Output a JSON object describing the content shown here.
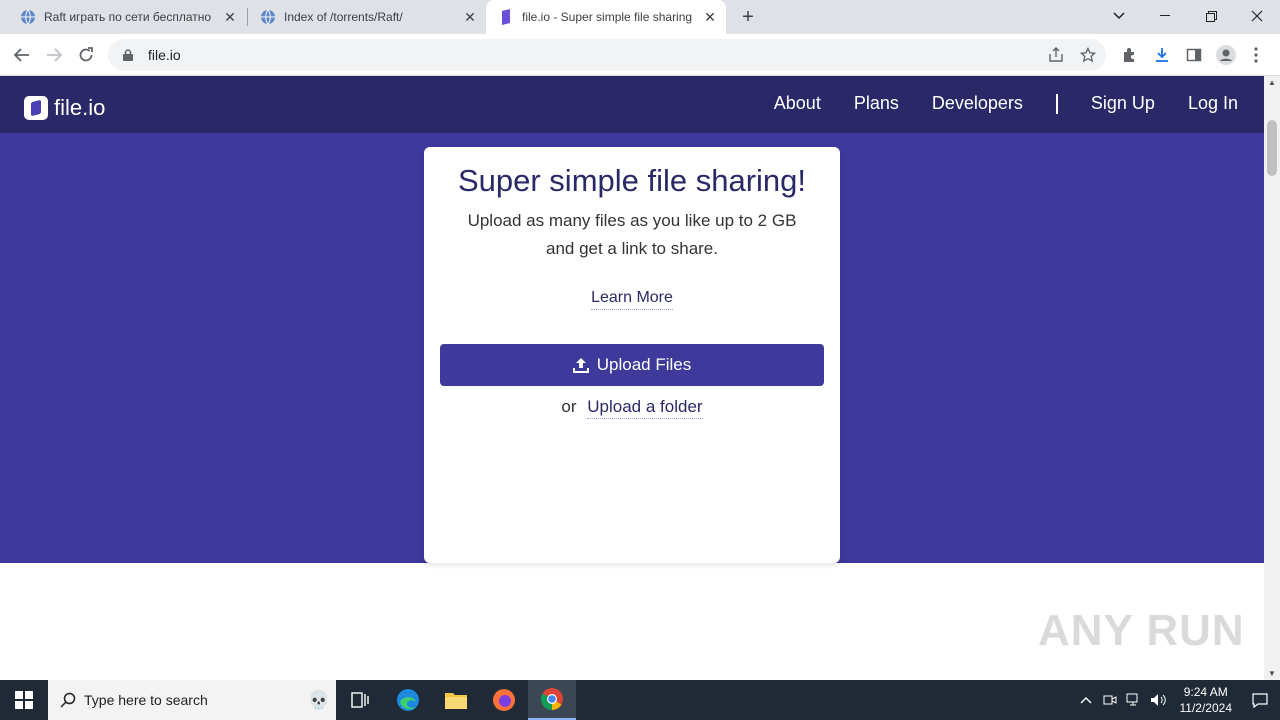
{
  "browser": {
    "tabs": [
      {
        "title": "Raft играть по сети бесплатно",
        "active": false
      },
      {
        "title": "Index of /torrents/Raft/",
        "active": false
      },
      {
        "title": "file.io - Super simple file sharing",
        "active": true
      }
    ],
    "url": "file.io"
  },
  "site": {
    "logo_text": "file.io",
    "nav": {
      "about": "About",
      "plans": "Plans",
      "developers": "Developers",
      "sign_up": "Sign Up",
      "log_in": "Log In"
    },
    "card": {
      "title": "Super simple file sharing!",
      "subtitle_line1": "Upload as many files as you like up to 2 GB",
      "subtitle_line2": "and get a link to share.",
      "learn_more": "Learn More",
      "upload_button": "Upload Files",
      "or_text": "or",
      "upload_folder": "Upload a folder"
    },
    "colors": {
      "nav_bg": "#2b2868",
      "hero_bg": "#3e399b",
      "accent": "#3e399b"
    }
  },
  "watermark": "ANY RUN",
  "taskbar": {
    "search_placeholder": "Type here to search",
    "time": "9:24 AM",
    "date": "11/2/2024"
  }
}
